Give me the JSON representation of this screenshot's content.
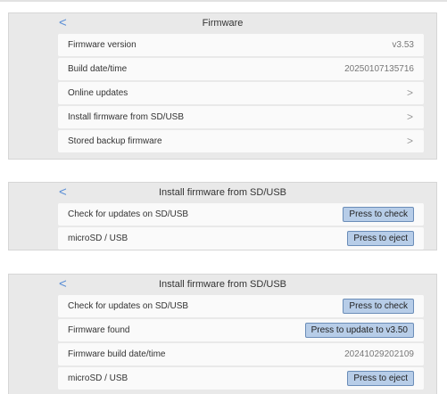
{
  "firmware_panel": {
    "title": "Firmware",
    "back_glyph": "<",
    "rows": [
      {
        "label": "Firmware version",
        "value": "v3.53"
      },
      {
        "label": "Build date/time",
        "value": "20250107135716"
      },
      {
        "label": "Online updates",
        "chevron": ">"
      },
      {
        "label": "Install firmware from SD/USB",
        "chevron": ">"
      },
      {
        "label": "Stored backup firmware",
        "chevron": ">"
      }
    ]
  },
  "install_panel_1": {
    "title": "Install firmware from SD/USB",
    "back_glyph": "<",
    "rows": [
      {
        "label": "Check for updates on SD/USB",
        "button": "Press to check"
      },
      {
        "label": "microSD / USB",
        "button": "Press to eject"
      }
    ]
  },
  "install_panel_2": {
    "title": "Install firmware from SD/USB",
    "back_glyph": "<",
    "rows": [
      {
        "label": "Check for updates on SD/USB",
        "button": "Press to check"
      },
      {
        "label": "Firmware found",
        "button": "Press to update to v3.50"
      },
      {
        "label": "Firmware build date/time",
        "value": "20241029202109"
      },
      {
        "label": "microSD / USB",
        "button": "Press to eject"
      }
    ]
  },
  "icons": {
    "back": "chevron-left-icon",
    "navigate": "chevron-right-icon"
  },
  "colors": {
    "accent": "#5b8fd6",
    "button_bg": "#b7cde8",
    "panel_bg": "#e9e9e9",
    "row_bg": "#fafafa"
  }
}
